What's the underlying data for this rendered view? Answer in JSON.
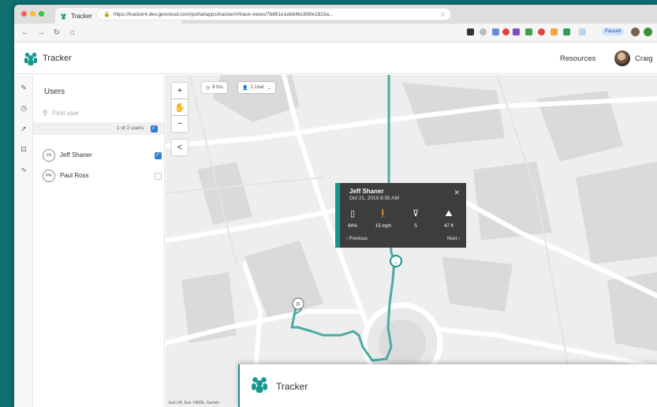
{
  "browser": {
    "tab_title": "Tracker",
    "tab_close": "×",
    "new_tab": "+",
    "url": "https://tracker4.dev.geocloud.com/portal/apps/tracker/#/track-views/7b891e1ebb4bc890e1823a...",
    "paused_label": "Paused"
  },
  "header": {
    "app_title": "Tracker",
    "resources": "Resources",
    "user_name": "Craig"
  },
  "users_panel": {
    "title": "Users",
    "search_placeholder": "Find user",
    "count": "1 of 2 users",
    "users": [
      {
        "initials": "JS",
        "name": "Jeff Shaner",
        "checked": true
      },
      {
        "initials": "PR",
        "name": "Paul Ross",
        "checked": false
      }
    ]
  },
  "map": {
    "time_chip": "8 hrs",
    "user_chip": "1 User",
    "attribution": "Esri UK, Esri, HERE, Garmin",
    "zoom_in": "+",
    "zoom_out": "−",
    "collapse": "<",
    "route_color": "#4aaba3"
  },
  "popup": {
    "name": "Jeff Shaner",
    "time": "Oct 21, 2019 8:05 AM",
    "close": "✕",
    "metrics": [
      {
        "icon": "battery-icon",
        "value": "94%"
      },
      {
        "icon": "walking-icon",
        "value": "15 mph"
      },
      {
        "icon": "compass-icon",
        "value": "S"
      },
      {
        "icon": "altitude-icon",
        "value": "47 ft"
      }
    ],
    "previous": "‹ Previous",
    "next": "Next ›"
  },
  "window2": {
    "app_title": "Tracker"
  },
  "colors": {
    "accent": "#17988f",
    "background": "#0f6e6e",
    "checkbox": "#2f7fd6"
  }
}
